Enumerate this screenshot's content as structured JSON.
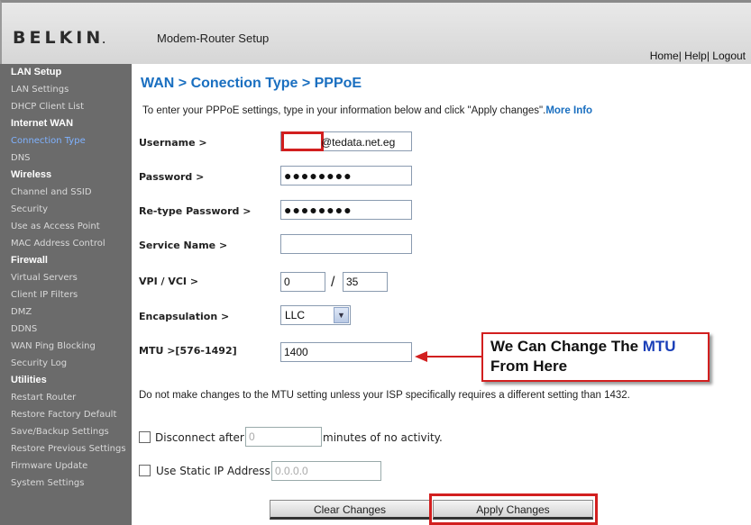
{
  "header": {
    "brand": "BELKIN",
    "product": "Modem-Router Setup",
    "links": [
      "Home",
      "Help",
      "Logout"
    ]
  },
  "sidebar": [
    {
      "section": "LAN Setup",
      "items": [
        "LAN Settings",
        "DHCP Client List"
      ]
    },
    {
      "section": "Internet WAN",
      "items": [
        "Connection Type",
        "DNS"
      ]
    },
    {
      "section": "Wireless",
      "items": [
        "Channel and SSID",
        "Security",
        "Use as Access Point",
        "MAC Address Control"
      ]
    },
    {
      "section": "Firewall",
      "items": [
        "Virtual Servers",
        "Client IP Filters",
        "DMZ",
        "DDNS",
        "WAN Ping Blocking",
        "Security Log"
      ]
    },
    {
      "section": "Utilities",
      "items": [
        "Restart Router",
        "Restore Factory Default",
        "Save/Backup Settings",
        "Restore Previous Settings",
        "Firmware Update",
        "System Settings"
      ]
    }
  ],
  "active_item": "Connection Type",
  "main": {
    "title": "WAN > Conection Type > PPPoE",
    "intro": "To enter your PPPoE settings, type in your information below and click \"Apply changes\".",
    "more_info": "More Info",
    "username_label": "Username >",
    "username_suffix": "@tedata.net.eg",
    "password_label": "Password >",
    "password_value": "●●●●●●●●",
    "retype_label": "Re-type Password >",
    "retype_value": "●●●●●●●●",
    "service_label": "Service Name >",
    "service_value": "",
    "vpi_label": "VPI / VCI >",
    "vpi_value": "0",
    "slash": "/",
    "vci_value": "35",
    "encap_label": "Encapsulation >",
    "encap_value": "LLC",
    "mtu_label": "MTU >[576-1492]",
    "mtu_value": "1400",
    "note": "Do not make changes to the MTU setting unless your ISP specifically requires a different setting than 1432.",
    "disconnect_label": "Disconnect after",
    "disconnect_value": "0",
    "disconnect_suffix": "minutes of no activity.",
    "static_ip_label": "Use Static IP Address",
    "static_ip_value": "0.0.0.0",
    "clear_button": "Clear Changes",
    "apply_button": "Apply Changes"
  },
  "callout": {
    "line1_prefix": "We Can Change The ",
    "line1_highlight": "MTU",
    "line2": "From Here"
  },
  "colors": {
    "accent_blue": "#1a6fc0",
    "highlight_red": "#d21f1f",
    "sidebar_bg": "#6b6b6b"
  }
}
